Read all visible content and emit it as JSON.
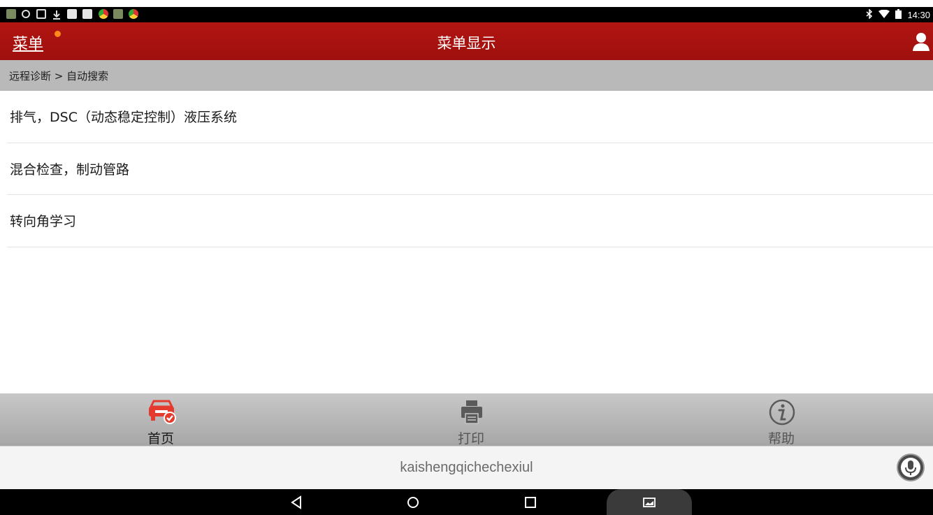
{
  "status_bar": {
    "time": "14:30",
    "left_icons": [
      "app-icon",
      "recycle-icon",
      "image-icon",
      "download-icon",
      "square-icon",
      "square-icon",
      "chrome-icon",
      "app-icon",
      "chrome-icon"
    ],
    "right_icons": [
      "bluetooth-icon",
      "wifi-icon",
      "battery-icon"
    ]
  },
  "app_bar": {
    "menu_label": "菜单",
    "title": "菜单显示",
    "notification_dot_color": "#ff8a1a",
    "background_color": "#a8120f"
  },
  "breadcrumb": {
    "text": "远程诊断 > 自动搜索"
  },
  "menu_items": [
    {
      "label": "排气，DSC（动态稳定控制）液压系统"
    },
    {
      "label": "混合检查，制动管路"
    },
    {
      "label": "转向角学习"
    }
  ],
  "bottom_nav": {
    "items": [
      {
        "label": "首页",
        "icon": "car-home-icon",
        "active": true
      },
      {
        "label": "打印",
        "icon": "printer-icon",
        "active": false
      },
      {
        "label": "帮助",
        "icon": "info-icon",
        "active": false
      }
    ],
    "active_color": "#e53a2e"
  },
  "input_bar": {
    "text": "kaishengqichechexiul",
    "button_icon": "microphone-icon"
  },
  "system_nav": {
    "icons": [
      "back-icon",
      "home-circle-icon",
      "recents-icon",
      "screenshot-icon"
    ]
  }
}
